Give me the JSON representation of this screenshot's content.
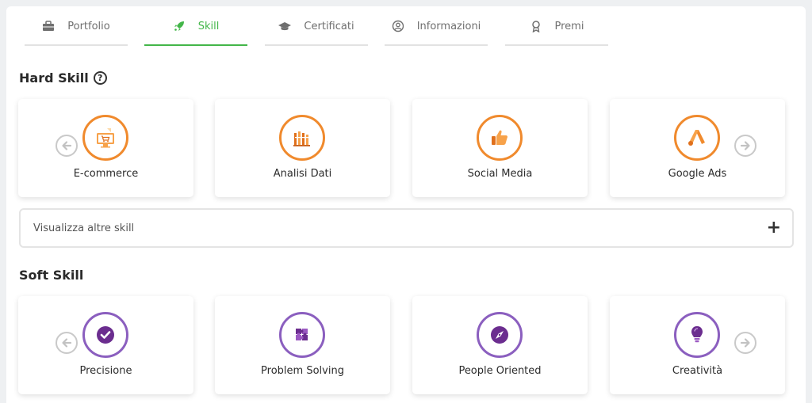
{
  "tabs": [
    {
      "label": "Portfolio",
      "icon": "briefcase-icon",
      "active": false
    },
    {
      "label": "Skill",
      "icon": "rocket-icon",
      "active": true
    },
    {
      "label": "Certificati",
      "icon": "graduation-cap-icon",
      "active": false
    },
    {
      "label": "Informazioni",
      "icon": "user-circle-icon",
      "active": false
    },
    {
      "label": "Premi",
      "icon": "award-icon",
      "active": false
    }
  ],
  "hard_skill": {
    "title": "Hard Skill",
    "help_symbol": "?",
    "items": [
      {
        "label": "E-commerce",
        "icon": "ecommerce-icon"
      },
      {
        "label": "Analisi Dati",
        "icon": "bar-chart-icon"
      },
      {
        "label": "Social Media",
        "icon": "thumbs-up-icon"
      },
      {
        "label": "Google Ads",
        "icon": "google-ads-icon"
      }
    ]
  },
  "expand": {
    "label": "Visualizza altre skill",
    "symbol": "+"
  },
  "soft_skill": {
    "title": "Soft Skill",
    "items": [
      {
        "label": "Precisione",
        "icon": "check-circle-icon"
      },
      {
        "label": "Problem Solving",
        "icon": "puzzle-icon"
      },
      {
        "label": "People Oriented",
        "icon": "compass-icon"
      },
      {
        "label": "Creatività",
        "icon": "lightbulb-icon"
      }
    ]
  },
  "colors": {
    "accent_green": "#43b649",
    "hard_ring": "#f08a2d",
    "soft_ring": "#8b5fbf",
    "soft_icon": "#6b2d8f"
  }
}
